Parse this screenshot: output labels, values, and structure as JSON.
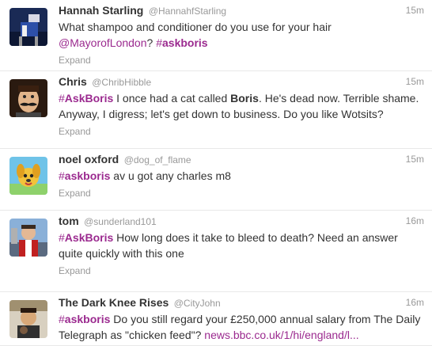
{
  "tweets": [
    {
      "fullname": "Hannah Starling",
      "username": "@HannahfStarling",
      "time": "15m",
      "text_pre": "What shampoo and conditioner do you use for your hair ",
      "mention": "@MayorofLondon",
      "text_mid": "? ",
      "hash": "#",
      "tag": "askboris",
      "expand": "Expand"
    },
    {
      "fullname": "Chris",
      "username": "@ChribHibble",
      "time": "15m",
      "hash": "#",
      "tag": "AskBoris",
      "text_a": " I once had a cat called ",
      "bold": "Boris",
      "text_b": ". He's dead now. Terrible shame. Anyway, I digress; let's get down to business. Do you like Wotsits?",
      "expand": "Expand"
    },
    {
      "fullname": "noel oxford",
      "username": "@dog_of_flame",
      "time": "15m",
      "hash": "#",
      "tag": "askboris",
      "text": " av u got any charles m8",
      "expand": "Expand"
    },
    {
      "fullname": "tom",
      "username": "@sunderland101",
      "time": "16m",
      "hash": "#",
      "tag": "AskBoris",
      "text": " How long does it take to bleed to death? Need an answer quite quickly with this one",
      "expand": "Expand"
    },
    {
      "fullname": "The Dark Knee Rises",
      "username": "@CityJohn",
      "time": "16m",
      "hash": "#",
      "tag": "askboris",
      "text": " Do you still regard your £250,000 annual salary from The Daily Telegraph as \"chicken feed\"? ",
      "link": "news.bbc.co.uk/1/hi/england/l..."
    }
  ],
  "colors": {
    "hashtag": "#9b2a8f",
    "meta": "#999999",
    "text": "#333333"
  }
}
